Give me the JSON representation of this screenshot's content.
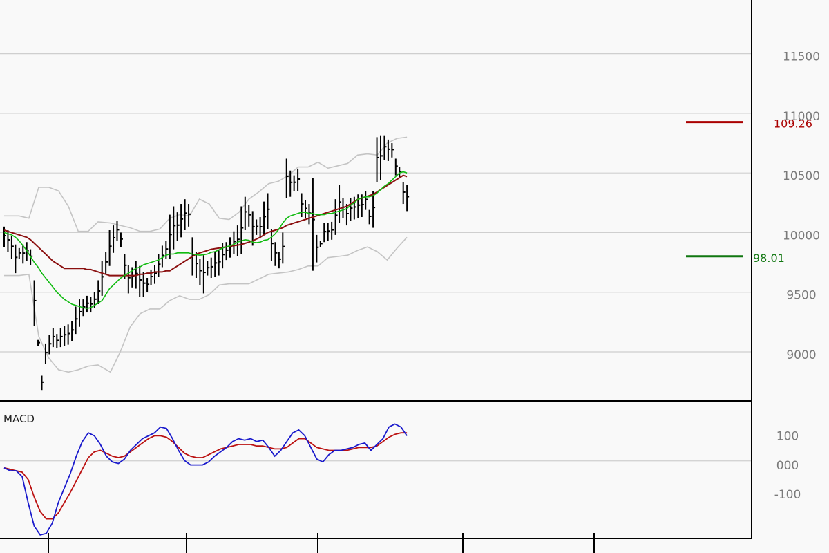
{
  "colors": {
    "background": "#f9f9f9",
    "grid": "#cfcfcf",
    "frame": "#000000",
    "price_bars": "#000000",
    "bollinger": "#c4c4c4",
    "ma_green": "#11bb11",
    "ma_red": "#8b1010",
    "macd_blue": "#1a1acc",
    "macd_signal": "#bb1111",
    "label_red": "#aa0000",
    "label_green": "#117711"
  },
  "chart_data": [
    {
      "type": "line",
      "subtype": "ohlc-bars with moving averages and bollinger bands",
      "title": "",
      "xlabel": "",
      "ylabel": "",
      "yticks": [
        {
          "value": 9000,
          "label": "9000"
        },
        {
          "value": 9500,
          "label": "9500"
        },
        {
          "value": 10000,
          "label": "10000"
        },
        {
          "value": 10500,
          "label": "10500"
        },
        {
          "value": 11000,
          "label": "11000"
        },
        {
          "value": 11500,
          "label": "11500"
        }
      ],
      "ylim": [
        8600,
        11950
      ],
      "grid": true,
      "highs": [
        10050,
        10020,
        9970,
        9900,
        9870,
        9900,
        9920,
        9860,
        9600,
        9100,
        8800,
        9070,
        9140,
        9200,
        9150,
        9200,
        9220,
        9230,
        9260,
        9380,
        9440,
        9440,
        9470,
        9460,
        9500,
        9600,
        9760,
        9840,
        10020,
        10060,
        10100,
        10000,
        9820,
        9730,
        9710,
        9760,
        9720,
        9670,
        9620,
        9690,
        9730,
        9820,
        9890,
        9930,
        10150,
        10220,
        10170,
        10240,
        10280,
        10240,
        9960,
        9840,
        9780,
        9810,
        9760,
        9790,
        9840,
        9850,
        9910,
        9920,
        9960,
        10010,
        10060,
        10220,
        10300,
        10230,
        10180,
        10110,
        10130,
        10260,
        10330,
        10030,
        9920,
        9840,
        10000,
        10620,
        10520,
        10480,
        10530,
        10330,
        10270,
        10240,
        10460,
        9980,
        9930,
        10080,
        10080,
        10090,
        10280,
        10400,
        10290,
        10240,
        10290,
        10300,
        10320,
        10320,
        10350,
        10190,
        10350,
        10800,
        10810,
        10810,
        10780,
        10750,
        10620,
        10550,
        10420,
        10400
      ],
      "lows": [
        9880,
        9840,
        9780,
        9660,
        9780,
        9740,
        9760,
        9730,
        9220,
        9050,
        8680,
        8900,
        8980,
        9040,
        9030,
        9040,
        9050,
        9060,
        9090,
        9150,
        9210,
        9300,
        9330,
        9330,
        9370,
        9400,
        9470,
        9650,
        9720,
        9830,
        9930,
        9880,
        9610,
        9490,
        9540,
        9530,
        9460,
        9460,
        9500,
        9560,
        9570,
        9630,
        9710,
        9780,
        9780,
        9860,
        9930,
        9960,
        10020,
        10050,
        9640,
        9620,
        9560,
        9490,
        9640,
        9620,
        9630,
        9640,
        9700,
        9770,
        9790,
        9820,
        9800,
        9820,
        10020,
        10050,
        9890,
        9980,
        9950,
        9980,
        10030,
        9760,
        9720,
        9700,
        9740,
        10290,
        10300,
        10350,
        10350,
        10130,
        10120,
        10070,
        9680,
        9750,
        9880,
        9920,
        9930,
        9940,
        9980,
        10080,
        10120,
        10060,
        10100,
        10110,
        10120,
        10130,
        10190,
        10070,
        10040,
        10420,
        10440,
        10610,
        10600,
        10630,
        10480,
        10460,
        10240,
        10180
      ],
      "ma_short": [
        10000,
        9990,
        9980,
        9960,
        9930,
        9890,
        9850,
        9800,
        9750,
        9710,
        9660,
        9620,
        9580,
        9540,
        9500,
        9470,
        9440,
        9420,
        9400,
        9390,
        9380,
        9370,
        9365,
        9370,
        9390,
        9410,
        9430,
        9480,
        9530,
        9560,
        9590,
        9620,
        9640,
        9660,
        9680,
        9700,
        9710,
        9730,
        9740,
        9750,
        9760,
        9770,
        9790,
        9810,
        9820,
        9820,
        9830,
        9830,
        9830,
        9830,
        9820,
        9815,
        9810,
        9815,
        9820,
        9835,
        9840,
        9855,
        9870,
        9880,
        9890,
        9900,
        9920,
        9930,
        9940,
        9935,
        9920,
        9915,
        9920,
        9935,
        9940,
        9960,
        9990,
        10030,
        10080,
        10120,
        10140,
        10150,
        10160,
        10170,
        10170,
        10160,
        10160,
        10150,
        10150,
        10150,
        10160,
        10160,
        10170,
        10180,
        10190,
        10200,
        10230,
        10250,
        10280,
        10290,
        10300,
        10300,
        10310,
        10330,
        10360,
        10390,
        10410,
        10440,
        10470,
        10500,
        10510,
        10500
      ],
      "ma_long": [
        10020,
        10010,
        10000,
        9990,
        9980,
        9970,
        9960,
        9940,
        9910,
        9880,
        9850,
        9820,
        9790,
        9760,
        9740,
        9720,
        9700,
        9700,
        9700,
        9700,
        9700,
        9700,
        9690,
        9690,
        9680,
        9670,
        9660,
        9650,
        9640,
        9640,
        9640,
        9640,
        9640,
        9640,
        9640,
        9640,
        9650,
        9650,
        9660,
        9660,
        9670,
        9670,
        9670,
        9680,
        9680,
        9700,
        9720,
        9740,
        9760,
        9780,
        9800,
        9820,
        9830,
        9840,
        9850,
        9860,
        9865,
        9870,
        9875,
        9880,
        9885,
        9890,
        9895,
        9900,
        9910,
        9920,
        9930,
        9945,
        9960,
        9980,
        10000,
        10010,
        10020,
        10030,
        10040,
        10060,
        10070,
        10080,
        10090,
        10100,
        10110,
        10120,
        10130,
        10140,
        10150,
        10160,
        10170,
        10180,
        10190,
        10200,
        10210,
        10220,
        10240,
        10260,
        10280,
        10290,
        10300,
        10310,
        10320,
        10340,
        10360,
        10380,
        10400,
        10420,
        10440,
        10460,
        10480,
        10470
      ],
      "boll_upper_points": [
        [
          0,
          10140
        ],
        [
          6,
          10140
        ],
        [
          10,
          10120
        ],
        [
          14,
          10380
        ],
        [
          18,
          10380
        ],
        [
          22,
          10350
        ],
        [
          26,
          10220
        ],
        [
          30,
          10010
        ],
        [
          34,
          10010
        ],
        [
          38,
          10090
        ],
        [
          43,
          10080
        ],
        [
          47,
          10060
        ],
        [
          51,
          10040
        ],
        [
          55,
          10010
        ],
        [
          59,
          10010
        ],
        [
          63,
          10030
        ],
        [
          67,
          10120
        ],
        [
          71,
          10150
        ],
        [
          75,
          10140
        ],
        [
          79,
          10280
        ],
        [
          83,
          10240
        ],
        [
          87,
          10120
        ],
        [
          91,
          10110
        ],
        [
          95,
          10170
        ],
        [
          99,
          10280
        ],
        [
          103,
          10340
        ],
        [
          107,
          10410
        ],
        [
          111,
          10430
        ],
        [
          115,
          10480
        ],
        [
          119,
          10550
        ],
        [
          123,
          10550
        ],
        [
          127,
          10590
        ],
        [
          131,
          10540
        ],
        [
          135,
          10560
        ],
        [
          139,
          10580
        ],
        [
          143,
          10650
        ],
        [
          147,
          10660
        ],
        [
          151,
          10650
        ],
        [
          155,
          10750
        ],
        [
          159,
          10790
        ],
        [
          163,
          10800
        ]
      ],
      "boll_lower_points": [
        [
          0,
          9640
        ],
        [
          6,
          9640
        ],
        [
          10,
          9650
        ],
        [
          14,
          9130
        ],
        [
          18,
          8950
        ],
        [
          22,
          8850
        ],
        [
          26,
          8830
        ],
        [
          30,
          8850
        ],
        [
          34,
          8880
        ],
        [
          38,
          8890
        ],
        [
          43,
          8830
        ],
        [
          47,
          9000
        ],
        [
          51,
          9210
        ],
        [
          55,
          9320
        ],
        [
          59,
          9360
        ],
        [
          63,
          9360
        ],
        [
          67,
          9430
        ],
        [
          71,
          9470
        ],
        [
          75,
          9440
        ],
        [
          79,
          9440
        ],
        [
          83,
          9480
        ],
        [
          87,
          9560
        ],
        [
          91,
          9570
        ],
        [
          95,
          9570
        ],
        [
          99,
          9570
        ],
        [
          103,
          9610
        ],
        [
          107,
          9650
        ],
        [
          111,
          9660
        ],
        [
          115,
          9670
        ],
        [
          119,
          9690
        ],
        [
          123,
          9720
        ],
        [
          127,
          9720
        ],
        [
          131,
          9790
        ],
        [
          135,
          9800
        ],
        [
          139,
          9810
        ],
        [
          143,
          9850
        ],
        [
          147,
          9880
        ],
        [
          151,
          9840
        ],
        [
          155,
          9770
        ],
        [
          159,
          9870
        ],
        [
          163,
          9960
        ]
      ],
      "last_value_labels": [
        {
          "label": "109.26",
          "value": 10926,
          "color": "#aa0000"
        },
        {
          "label": "98.01",
          "value": 9801,
          "color": "#117711"
        }
      ]
    },
    {
      "type": "line",
      "title": "MACD",
      "xlabel": "",
      "ylabel": "",
      "yticks": [
        {
          "value": 100,
          "label": "100"
        },
        {
          "value": 0,
          "label": "000"
        },
        {
          "value": -100,
          "label": "-100"
        }
      ],
      "ylim": [
        -240,
        220
      ],
      "zero_line": true,
      "macd_points": [
        [
          0,
          0
        ],
        [
          3,
          -10
        ],
        [
          6,
          -10
        ],
        [
          9,
          -30
        ],
        [
          12,
          -120
        ],
        [
          15,
          -200
        ],
        [
          18,
          -230
        ],
        [
          21,
          -225
        ],
        [
          24,
          -190
        ],
        [
          27,
          -120
        ],
        [
          30,
          -70
        ],
        [
          33,
          -20
        ],
        [
          36,
          40
        ],
        [
          39,
          90
        ],
        [
          42,
          120
        ],
        [
          45,
          110
        ],
        [
          48,
          80
        ],
        [
          51,
          40
        ],
        [
          54,
          20
        ],
        [
          57,
          15
        ],
        [
          60,
          30
        ],
        [
          63,
          60
        ],
        [
          66,
          80
        ],
        [
          69,
          100
        ],
        [
          72,
          110
        ],
        [
          75,
          120
        ],
        [
          78,
          140
        ],
        [
          81,
          135
        ],
        [
          84,
          100
        ],
        [
          87,
          60
        ],
        [
          90,
          25
        ],
        [
          93,
          10
        ],
        [
          96,
          10
        ],
        [
          99,
          10
        ],
        [
          102,
          20
        ],
        [
          105,
          40
        ],
        [
          108,
          55
        ],
        [
          111,
          70
        ],
        [
          114,
          90
        ],
        [
          117,
          100
        ],
        [
          120,
          95
        ],
        [
          123,
          100
        ],
        [
          126,
          90
        ],
        [
          129,
          95
        ],
        [
          132,
          70
        ],
        [
          135,
          40
        ],
        [
          138,
          60
        ],
        [
          141,
          90
        ],
        [
          144,
          120
        ],
        [
          147,
          130
        ],
        [
          150,
          110
        ],
        [
          153,
          70
        ],
        [
          156,
          30
        ],
        [
          159,
          20
        ],
        [
          162,
          45
        ],
        [
          165,
          60
        ],
        [
          168,
          60
        ],
        [
          171,
          65
        ],
        [
          174,
          70
        ],
        [
          177,
          80
        ],
        [
          180,
          85
        ],
        [
          183,
          60
        ],
        [
          186,
          80
        ],
        [
          189,
          100
        ],
        [
          192,
          140
        ],
        [
          195,
          150
        ],
        [
          198,
          140
        ],
        [
          201,
          110
        ]
      ],
      "signal_points": [
        [
          0,
          0
        ],
        [
          3,
          -5
        ],
        [
          6,
          -10
        ],
        [
          9,
          -15
        ],
        [
          12,
          -40
        ],
        [
          15,
          -100
        ],
        [
          18,
          -150
        ],
        [
          21,
          -175
        ],
        [
          24,
          -175
        ],
        [
          27,
          -155
        ],
        [
          30,
          -120
        ],
        [
          33,
          -85
        ],
        [
          36,
          -45
        ],
        [
          39,
          -5
        ],
        [
          42,
          35
        ],
        [
          45,
          55
        ],
        [
          48,
          60
        ],
        [
          51,
          50
        ],
        [
          54,
          40
        ],
        [
          57,
          35
        ],
        [
          60,
          40
        ],
        [
          63,
          55
        ],
        [
          66,
          70
        ],
        [
          69,
          85
        ],
        [
          72,
          100
        ],
        [
          75,
          110
        ],
        [
          78,
          110
        ],
        [
          81,
          105
        ],
        [
          84,
          90
        ],
        [
          87,
          70
        ],
        [
          90,
          50
        ],
        [
          93,
          40
        ],
        [
          96,
          35
        ],
        [
          99,
          35
        ],
        [
          102,
          45
        ],
        [
          105,
          55
        ],
        [
          108,
          65
        ],
        [
          111,
          70
        ],
        [
          114,
          75
        ],
        [
          117,
          80
        ],
        [
          120,
          80
        ],
        [
          123,
          80
        ],
        [
          126,
          75
        ],
        [
          129,
          75
        ],
        [
          132,
          70
        ],
        [
          135,
          65
        ],
        [
          138,
          65
        ],
        [
          141,
          70
        ],
        [
          144,
          85
        ],
        [
          147,
          100
        ],
        [
          150,
          100
        ],
        [
          153,
          85
        ],
        [
          156,
          70
        ],
        [
          159,
          65
        ],
        [
          162,
          60
        ],
        [
          165,
          60
        ],
        [
          168,
          60
        ],
        [
          171,
          60
        ],
        [
          174,
          65
        ],
        [
          177,
          70
        ],
        [
          180,
          70
        ],
        [
          183,
          70
        ],
        [
          186,
          75
        ],
        [
          189,
          90
        ],
        [
          192,
          105
        ],
        [
          195,
          115
        ],
        [
          198,
          120
        ],
        [
          201,
          120
        ]
      ]
    }
  ]
}
